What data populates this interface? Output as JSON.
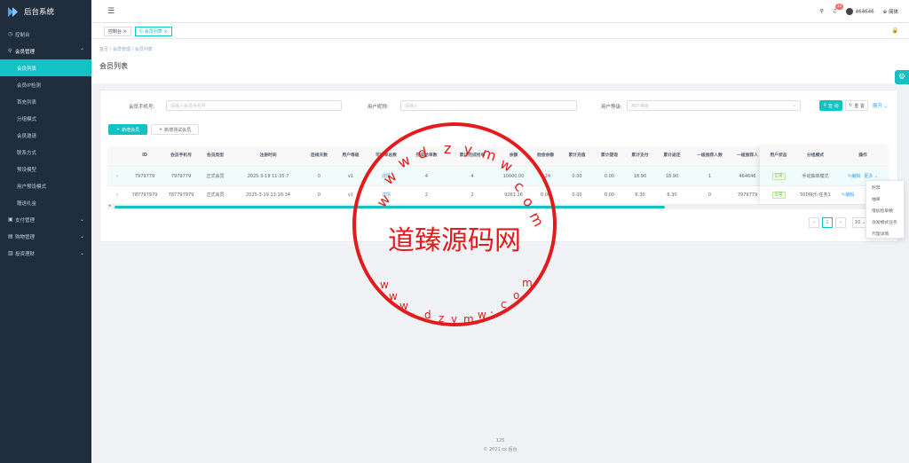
{
  "app": {
    "title": "后台系统"
  },
  "sidebar": {
    "items": [
      {
        "label": "控制台",
        "icon": "dashboard-icon"
      },
      {
        "label": "会员管理",
        "icon": "user-icon",
        "expanded": true,
        "children": [
          {
            "label": "会员列表",
            "active": true
          },
          {
            "label": "会员IP检测"
          },
          {
            "label": "首充列表"
          },
          {
            "label": "分组模式"
          },
          {
            "label": "会员邀请"
          },
          {
            "label": "联系方式"
          },
          {
            "label": "预设模型"
          },
          {
            "label": "用户预设模式"
          },
          {
            "label": "赠送礼金"
          }
        ]
      },
      {
        "label": "支付管理",
        "icon": "wallet-icon"
      },
      {
        "label": "购物管理",
        "icon": "cart-icon"
      },
      {
        "label": "投资理财",
        "icon": "chart-icon"
      }
    ]
  },
  "topbar": {
    "badge": "12",
    "username": "464646",
    "lang": "简体"
  },
  "tags": [
    {
      "label": "控制台"
    },
    {
      "label": "会员列表",
      "active": true
    }
  ],
  "breadcrumb": "首页 / 会员管理 / 会员列表",
  "page_title": "会员列表",
  "filters": {
    "phone_label": "会员手机号:",
    "phone_placeholder": "请输入会员手机号",
    "nick_label": "用户昵称:",
    "nick_placeholder": "请输入",
    "level_label": "用户等级:",
    "level_placeholder": "用户等级",
    "search": "查 询",
    "reset": "重 置",
    "expand": "展开"
  },
  "actions": {
    "add": "新增会员",
    "add_test": "新增测试会员"
  },
  "table": {
    "columns": [
      "ID",
      "会员手机号",
      "会员类型",
      "注册时间",
      "连续天数",
      "用户等级",
      "可抢单总数",
      "完成抢单数",
      "累计完成抢单",
      "余额",
      "佣金余额",
      "累计充值",
      "累计提现",
      "累计支付",
      "累计返还",
      "一级推荐人数",
      "一级推荐人",
      "用户状态",
      "分组模式",
      "操作"
    ],
    "rows": [
      {
        "id": "7979779",
        "phone": "7979779",
        "type": "正式会员",
        "reg": "2025-3-19 11:35:7",
        "days": "0",
        "level": "v1",
        "grab": "详情",
        "done": "4",
        "total": "4",
        "balance": "10000.00",
        "commission": "0.24",
        "recharge": "0.00",
        "withdraw": "0.00",
        "pay": "18.90",
        "refund": "18.90",
        "ref_count": "1",
        "referrer": "464646",
        "status": "正常",
        "group": "手动抽单模式",
        "edit": "编辑",
        "more": "更多"
      },
      {
        "id": "787797979",
        "phone": "787797979",
        "type": "正式会员",
        "reg": "2025-3-19 13:10:34",
        "days": "0",
        "level": "v1",
        "grab": "详情",
        "done": "2",
        "total": "2",
        "balance": "9261.26",
        "commission": "0.00",
        "recharge": "0.00",
        "withdraw": "0.00",
        "pay": "6.30",
        "refund": "6.30",
        "ref_count": "0",
        "referrer": "7979779",
        "status": "正常",
        "group": "500快乐-任务1",
        "edit": "编辑",
        "more": ""
      }
    ]
  },
  "pager": {
    "page": "1",
    "size": "10"
  },
  "dropdown": [
    "封禁",
    "抽单",
    "增加抢单数",
    "派发模式任务",
    "代理详情"
  ],
  "footer": {
    "count": "125",
    "copy": "© 2021 cx 后台"
  },
  "watermark": {
    "text": "道臻源码网",
    "arc": "dzym",
    "url": "www.dzym.com"
  }
}
